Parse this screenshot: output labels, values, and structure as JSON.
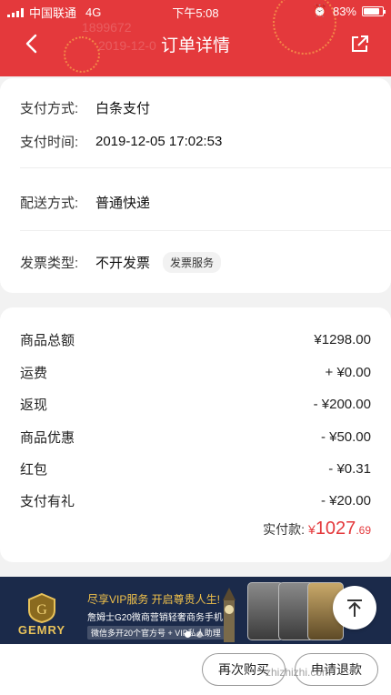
{
  "status_bar": {
    "carrier": "中国联通",
    "network": "4G",
    "time": "下午5:08",
    "battery_percent": "83%",
    "battery_level": 0.83
  },
  "header": {
    "title": "订单详情",
    "background_color": "#e4393c",
    "ghost_text_1": "1899672",
    "ghost_text_2": "2019-12-0"
  },
  "payment_info": {
    "rows": [
      {
        "label": "支付方式:",
        "value": "白条支付"
      },
      {
        "label": "支付时间:",
        "value": "2019-12-05 17:02:53"
      },
      {
        "label": "配送方式:",
        "value": "普通快递"
      },
      {
        "label": "发票类型:",
        "value": "不开发票"
      }
    ],
    "invoice_service_tag": "发票服务"
  },
  "price_breakdown": {
    "rows": [
      {
        "label": "商品总额",
        "value": "¥1298.00"
      },
      {
        "label": "运费",
        "value": "+ ¥0.00"
      },
      {
        "label": "返现",
        "value": "- ¥200.00"
      },
      {
        "label": "商品优惠",
        "value": "- ¥50.00"
      },
      {
        "label": "红包",
        "value": "- ¥0.31"
      },
      {
        "label": "支付有礼",
        "value": "- ¥20.00"
      }
    ],
    "total_label": "实付款:",
    "total_currency": "¥",
    "total_integer": "1027",
    "total_decimal": ".69",
    "accent_color": "#e4393c"
  },
  "banner": {
    "brand": "GEMRY",
    "line1": "尽享VIP服务  开启尊贵人生!",
    "line2": "詹姆士G20微商营销轻奢商务手机",
    "line3": "微信多开20个官方号 + VIP私人助理",
    "active_slide": 1,
    "slide_count": 2
  },
  "bottom_bar": {
    "rebuy_label": "再次购买",
    "refund_label": "申请退款"
  },
  "watermark": "zhizhizhi.com"
}
